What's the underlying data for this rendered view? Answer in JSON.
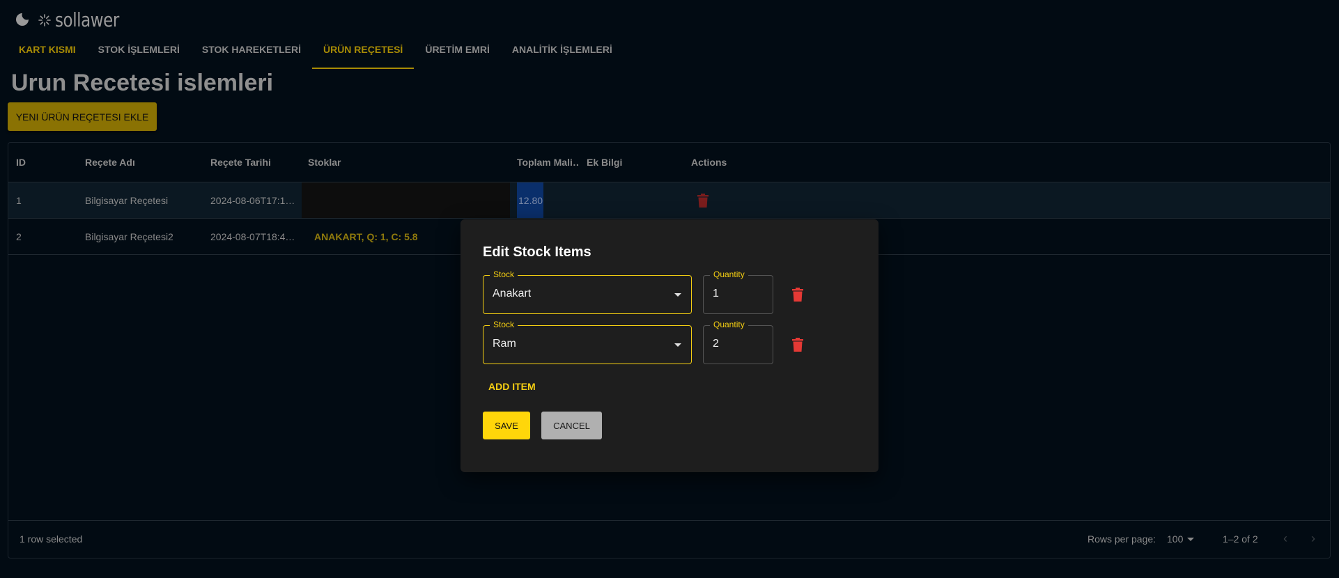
{
  "header": {
    "brand": "sollawer",
    "theme_icon": "moon-icon",
    "logo_icon": "spinner-icon"
  },
  "nav": {
    "tabs": [
      {
        "label": "KART KISMI"
      },
      {
        "label": "STOK İŞLEMLERİ"
      },
      {
        "label": "STOK HAREKETLERİ"
      },
      {
        "label": "ÜRÜN REÇETESİ"
      },
      {
        "label": "ÜRETİM EMRİ"
      },
      {
        "label": "ANALİTİK İŞLEMLERİ"
      }
    ],
    "active": "ÜRÜN REÇETESİ"
  },
  "page": {
    "title": "Urun Recetesi islemleri",
    "add_button": "YENI ÜRÜN REÇETESI EKLE"
  },
  "grid": {
    "columns": {
      "id": "ID",
      "name": "Reçete Adı",
      "date": "Reçete Tarihi",
      "stocks": "Stoklar",
      "cost": "Toplam Mali…",
      "info": "Ek Bilgi",
      "actions": "Actions"
    },
    "rows": [
      {
        "id": "1",
        "name": "Bilgisayar Reçetesi",
        "date": "2024-08-06T17:1…",
        "stocks": "",
        "cost": "12.80",
        "info": ""
      },
      {
        "id": "2",
        "name": "Bilgisayar Reçetesi2",
        "date": "2024-08-07T18:4…",
        "stocks": "ANAKART, Q: 1, C: 5.8",
        "cost": "",
        "info": ""
      }
    ],
    "footer": {
      "selection": "1 row selected",
      "rows_per_page_label": "Rows per page:",
      "rows_per_page_value": "100",
      "range": "1–2 of 2"
    }
  },
  "modal": {
    "title": "Edit Stock Items",
    "items": [
      {
        "stock_label": "Stock",
        "stock_value": "Anakart",
        "qty_label": "Quantity",
        "qty_value": "1"
      },
      {
        "stock_label": "Stock",
        "stock_value": "Ram",
        "qty_label": "Quantity",
        "qty_value": "2"
      }
    ],
    "add_item": "ADD ITEM",
    "save": "SAVE",
    "cancel": "CANCEL"
  },
  "colors": {
    "accent": "#ffd60a",
    "delete": "#e53935",
    "background": "#020b13"
  }
}
